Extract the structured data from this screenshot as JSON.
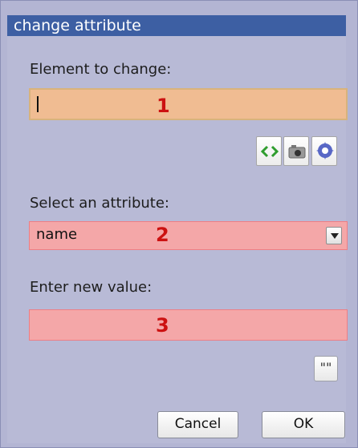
{
  "dialog": {
    "title": "change attribute"
  },
  "element": {
    "label": "Element to change:",
    "value": "",
    "marker": "1"
  },
  "toolbar": {
    "icons": [
      "code-brackets-icon",
      "camera-icon",
      "gear-icon"
    ]
  },
  "attribute": {
    "label": "Select an attribute:",
    "selected": "name",
    "marker": "2"
  },
  "new_value": {
    "label": "Enter new value:",
    "value": "",
    "marker": "3"
  },
  "quote_button": {
    "label": "\"\""
  },
  "buttons": {
    "cancel": "Cancel",
    "ok": "OK"
  }
}
